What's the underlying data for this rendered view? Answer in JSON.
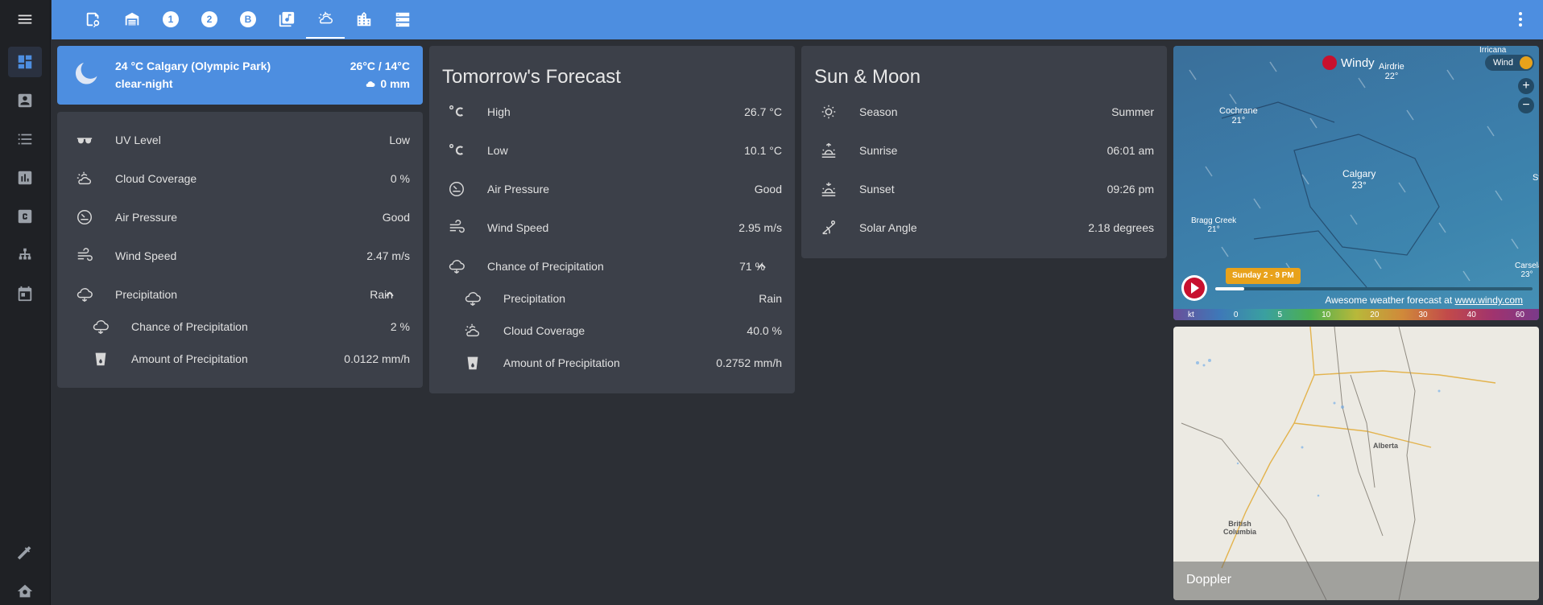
{
  "nav": {
    "tabs": [
      "notes-icon",
      "garage-icon",
      "floor-1-icon",
      "floor-2-icon",
      "basement-icon",
      "media-icon",
      "weather-icon",
      "city-icon",
      "server-icon"
    ],
    "floor1": "1",
    "floor2": "2",
    "basement": "B"
  },
  "sidebar": {
    "items": [
      "menu-icon",
      "dashboard-icon",
      "contacts-icon",
      "list-icon",
      "chart-icon",
      "c-icon",
      "network-icon",
      "calendar-icon",
      "hammer-icon",
      "home-settings-icon"
    ]
  },
  "current": {
    "title": "24 °C Calgary (Olympic Park)",
    "temp_range": "26°C / 14°C",
    "condition": "clear-night",
    "precip": "0 mm"
  },
  "today": {
    "rows": [
      {
        "label": "UV Level",
        "value": "Low"
      },
      {
        "label": "Cloud Coverage",
        "value": "0 %"
      },
      {
        "label": "Air Pressure",
        "value": "Good"
      },
      {
        "label": "Wind Speed",
        "value": "2.47 m/s"
      },
      {
        "label": "Precipitation",
        "value": "Rain"
      }
    ],
    "sub": [
      {
        "label": "Chance of Precipitation",
        "value": "2 %"
      },
      {
        "label": "Amount of Precipitation",
        "value": "0.0122 mm/h"
      }
    ]
  },
  "tomorrow": {
    "title": "Tomorrow's Forecast",
    "rows": [
      {
        "label": "High",
        "value": "26.7 °C"
      },
      {
        "label": "Low",
        "value": "10.1 °C"
      },
      {
        "label": "Air Pressure",
        "value": "Good"
      },
      {
        "label": "Wind Speed",
        "value": "2.95 m/s"
      },
      {
        "label": "Chance of Precipitation",
        "value": "71 %"
      }
    ],
    "sub": [
      {
        "label": "Precipitation",
        "value": "Rain"
      },
      {
        "label": "Cloud Coverage",
        "value": "40.0 %"
      },
      {
        "label": "Amount of Precipitation",
        "value": "0.2752 mm/h"
      }
    ]
  },
  "sunmoon": {
    "title": "Sun & Moon",
    "rows": [
      {
        "label": "Season",
        "value": "Summer"
      },
      {
        "label": "Sunrise",
        "value": "06:01 am"
      },
      {
        "label": "Sunset",
        "value": "09:26 pm"
      },
      {
        "label": "Solar Angle",
        "value": "2.18 degrees"
      }
    ]
  },
  "windy": {
    "brand": "Windy",
    "layer": "Wind",
    "time": "Sunday 2 - 9 PM",
    "footer": "Awesome weather forecast at",
    "footer_link": "www.windy.com",
    "zoom_in": "+",
    "zoom_out": "−",
    "scale_unit": "kt",
    "scale": [
      "0",
      "5",
      "10",
      "20",
      "30",
      "40",
      "60"
    ],
    "cities": [
      {
        "name": "Irricana",
        "temp": ""
      },
      {
        "name": "Airdrie",
        "temp": "22°"
      },
      {
        "name": "Cochrane",
        "temp": "21°"
      },
      {
        "name": "Calgary",
        "temp": "23°"
      },
      {
        "name": "Bragg Creek",
        "temp": "21°"
      },
      {
        "name": "Carseland",
        "temp": "23°"
      },
      {
        "name": "St",
        "temp": ""
      }
    ]
  },
  "doppler": {
    "label": "Doppler",
    "places": [
      "Alberta",
      "British",
      "Columbia"
    ]
  },
  "colors": {
    "accent": "#4d8ee0",
    "card": "#3c4049",
    "bg": "#2c2f35"
  }
}
